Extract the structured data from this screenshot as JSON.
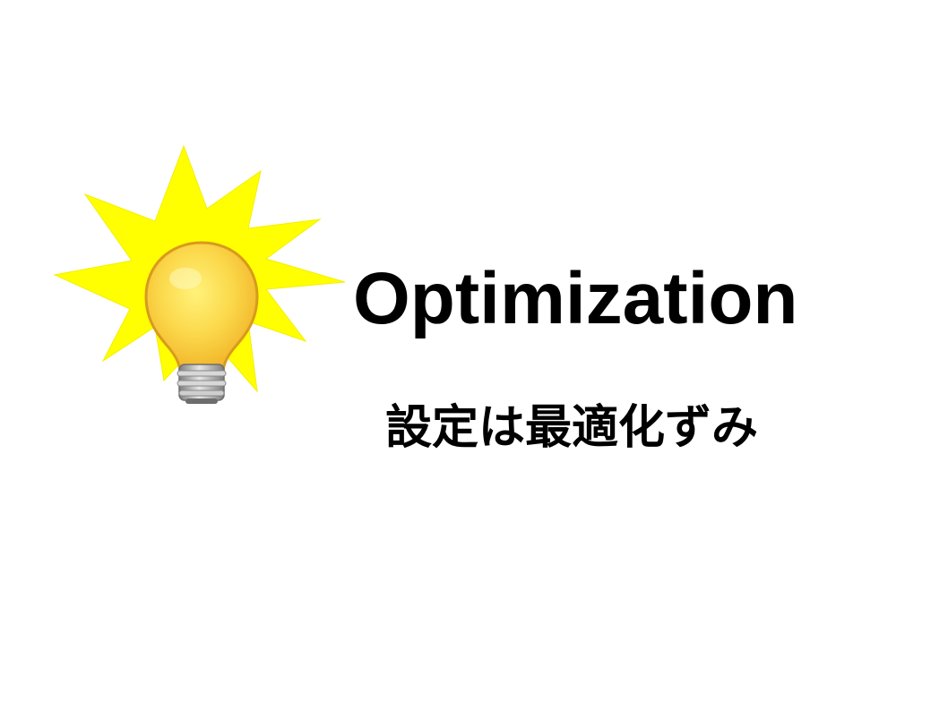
{
  "slide": {
    "title": "Optimization",
    "subtitle": "設定は最適化ずみ",
    "icon": "lightbulb-burst-icon"
  },
  "colors": {
    "background": "#ffffff",
    "burst": "#ffff00",
    "bulb_glass": "#f9c93a",
    "bulb_outline": "#d99a1d",
    "bulb_base": "#9a9a9a",
    "text": "#000000"
  }
}
